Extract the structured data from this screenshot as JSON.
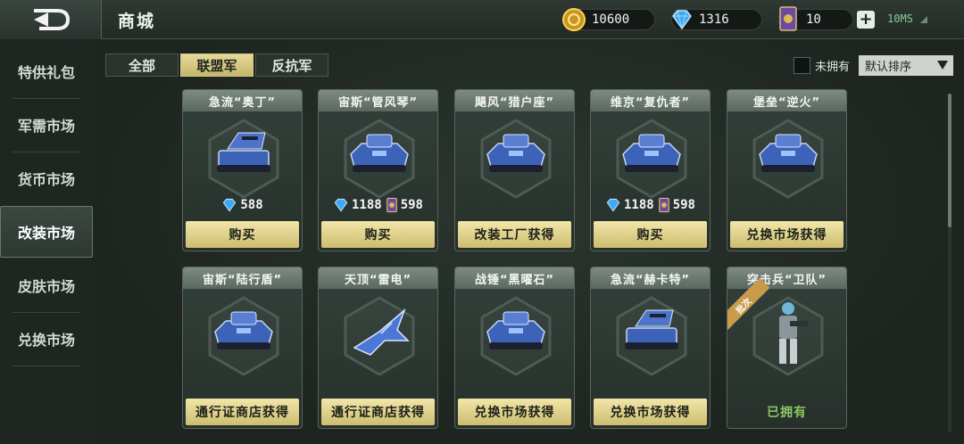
{
  "header": {
    "title": "商城",
    "gold": "10600",
    "diamonds": "1316",
    "cards": "10",
    "ping": "10MS"
  },
  "sidebar": {
    "items": [
      {
        "label": "特供礼包"
      },
      {
        "label": "军需市场"
      },
      {
        "label": "货币市场"
      },
      {
        "label": "改装市场",
        "active": true
      },
      {
        "label": "皮肤市场"
      },
      {
        "label": "兑换市场"
      }
    ]
  },
  "tabs": [
    {
      "label": "全部"
    },
    {
      "label": "联盟军",
      "active": true
    },
    {
      "label": "反抗军"
    }
  ],
  "filter": {
    "unowned_label": "未拥有",
    "sort_value": "默认排序"
  },
  "items": [
    {
      "name": "急流“奥丁”",
      "diamond_price": "588",
      "card_price": "",
      "button": "购买",
      "icon": "rocket-tank-icon"
    },
    {
      "name": "宙斯“管风琴”",
      "diamond_price": "1188",
      "card_price": "598",
      "button": "购买",
      "icon": "tank-icon"
    },
    {
      "name": "飓风“猎户座”",
      "diamond_price": "",
      "card_price": "",
      "button": "改装工厂获得",
      "icon": "tank-icon"
    },
    {
      "name": "维京“复仇者”",
      "diamond_price": "1188",
      "card_price": "598",
      "button": "购买",
      "icon": "tank-icon"
    },
    {
      "name": "堡垒“逆火”",
      "diamond_price": "",
      "card_price": "",
      "button": "兑换市场获得",
      "icon": "tank-icon"
    },
    {
      "name": "宙斯“陆行盾”",
      "diamond_price": "",
      "card_price": "",
      "button": "通行证商店获得",
      "icon": "tank-icon"
    },
    {
      "name": "天顶“雷电”",
      "diamond_price": "",
      "card_price": "",
      "button": "通行证商店获得",
      "icon": "jet-icon"
    },
    {
      "name": "战锤“黑曜石”",
      "diamond_price": "",
      "card_price": "",
      "button": "兑换市场获得",
      "icon": "tank-icon"
    },
    {
      "name": "急流“赫卡特”",
      "diamond_price": "",
      "card_price": "",
      "button": "兑换市场获得",
      "icon": "rocket-tank-icon"
    },
    {
      "name": "突击兵“卫队”",
      "diamond_price": "",
      "card_price": "",
      "button": "已拥有",
      "owned": true,
      "ribbon": "批次",
      "icon": "soldier-icon"
    }
  ],
  "colors": {
    "accent_gold": "#d9ca80",
    "owned_green": "#8bc862",
    "diamond_blue": "#3fa9f5"
  }
}
